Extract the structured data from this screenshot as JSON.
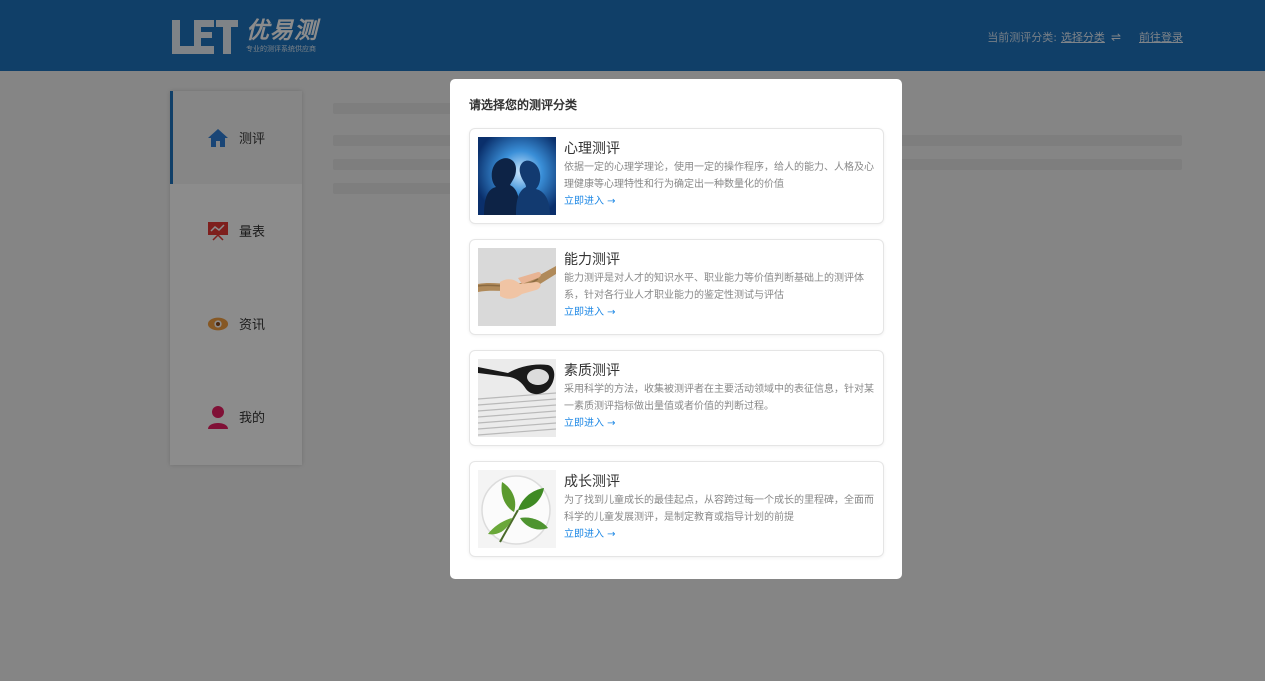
{
  "header": {
    "logo_text": "优易测",
    "logo_sub": "专业的测评系统供应商",
    "category_prefix": "当前测评分类:",
    "choose_category": "选择分类",
    "swap_icon": "⇌",
    "login_link": "前往登录"
  },
  "sidebar": {
    "items": [
      {
        "label": "测评",
        "icon": "home-icon"
      },
      {
        "label": "量表",
        "icon": "chart-board-icon"
      },
      {
        "label": "资讯",
        "icon": "eye-icon"
      },
      {
        "label": "我的",
        "icon": "user-icon"
      }
    ]
  },
  "modal": {
    "title": "请选择您的测评分类",
    "cards": [
      {
        "title": "心理测评",
        "desc": "依据一定的心理学理论，使用一定的操作程序，给人的能力、人格及心理健康等心理特性和行为确定出一种数量化的价值",
        "link": "立即进入 →"
      },
      {
        "title": "能力测评",
        "desc": "能力测评是对人才的知识水平、职业能力等价值判断基础上的测评体系，针对各行业人才职业能力的鉴定性测试与评估",
        "link": "立即进入 →"
      },
      {
        "title": "素质测评",
        "desc": "采用科学的方法，收集被测评者在主要活动领域中的表征信息，针对某一素质测评指标做出量值或者价值的判断过程。",
        "link": "立即进入 →"
      },
      {
        "title": "成长测评",
        "desc": "为了找到儿童成长的最佳起点，从容跨过每一个成长的里程碑，全面而科学的儿童发展测评，是制定教育或指导计划的前提",
        "link": "立即进入 →"
      }
    ]
  },
  "colors": {
    "brand": "#1e73be",
    "link": "#1e88e5"
  }
}
